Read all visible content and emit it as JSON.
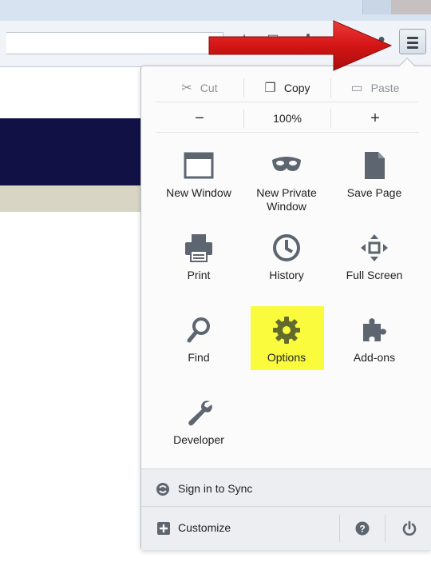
{
  "browser": {
    "toolbar_icons": [
      "bookmark-star-icon",
      "bookmarks-list-icon",
      "download-icon",
      "home-icon",
      "sync-circle-icon"
    ]
  },
  "menu": {
    "edit": {
      "cut": "Cut",
      "copy": "Copy",
      "paste": "Paste"
    },
    "zoom": {
      "minus": "−",
      "level": "100%",
      "plus": "+"
    },
    "items": [
      {
        "label": "New Window",
        "icon": "window-icon"
      },
      {
        "label": "New Private Window",
        "icon": "mask-icon"
      },
      {
        "label": "Save Page",
        "icon": "page-icon"
      },
      {
        "label": "Print",
        "icon": "printer-icon"
      },
      {
        "label": "History",
        "icon": "clock-icon"
      },
      {
        "label": "Full Screen",
        "icon": "fullscreen-icon"
      },
      {
        "label": "Find",
        "icon": "magnifier-icon"
      },
      {
        "label": "Options",
        "icon": "gear-icon",
        "highlighted": true
      },
      {
        "label": "Add-ons",
        "icon": "puzzle-icon"
      },
      {
        "label": "Developer",
        "icon": "wrench-icon"
      }
    ],
    "sync_label": "Sign in to Sync",
    "customize_label": "Customize"
  },
  "colors": {
    "highlight": "#fafb3c",
    "arrow": "#d41515",
    "banner_dark": "#121146",
    "banner_light": "#d8d5c5"
  }
}
